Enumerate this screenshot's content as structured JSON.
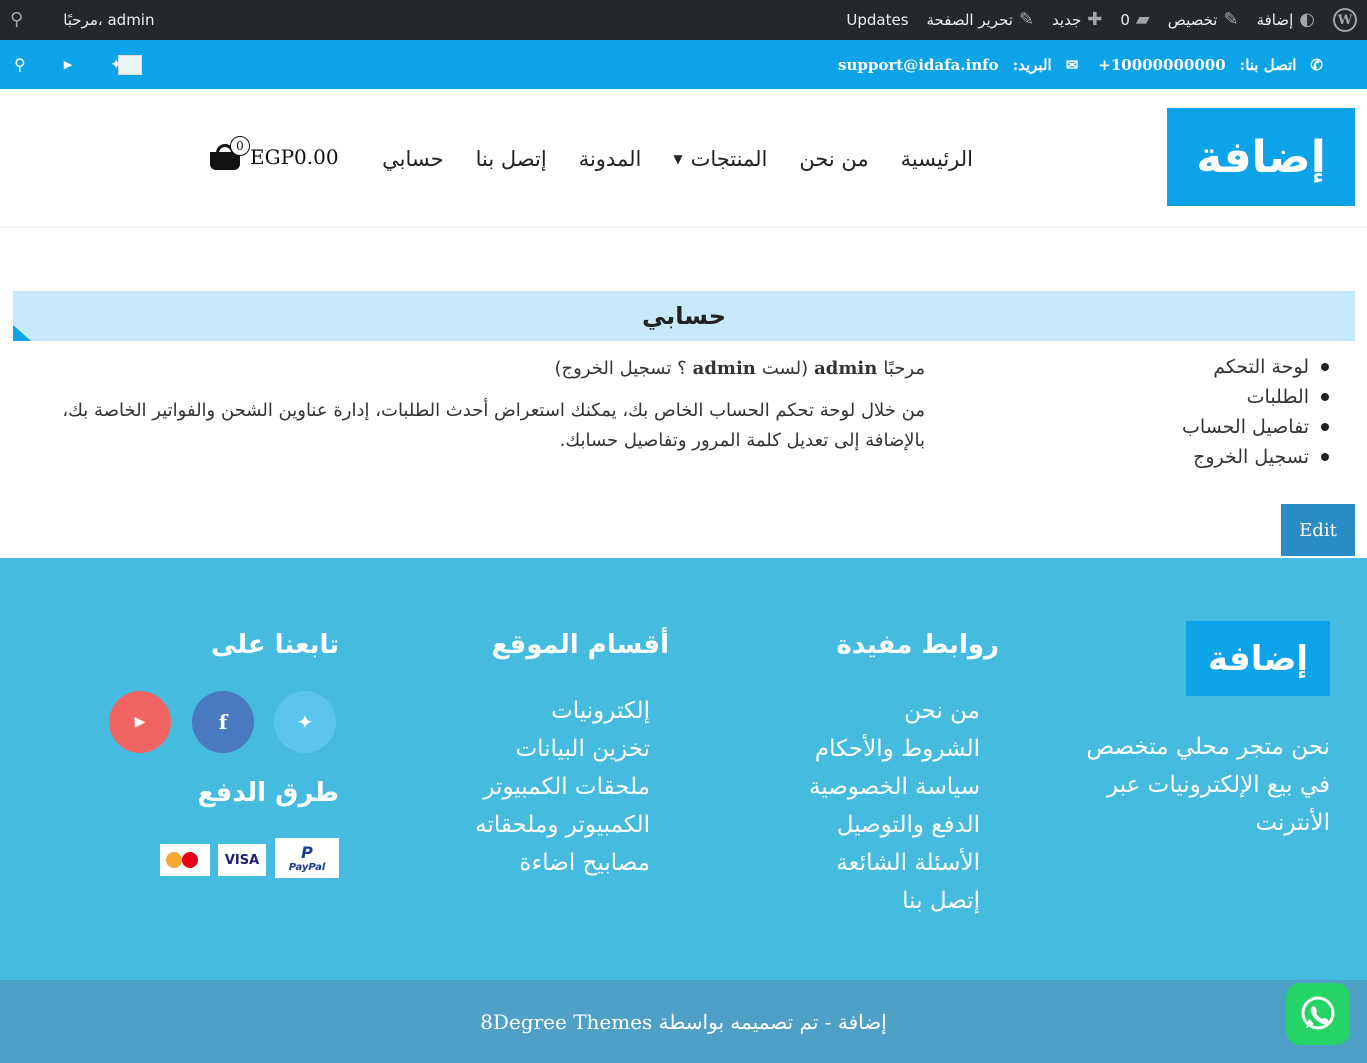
{
  "admin_bar": {
    "site_name": "إضافة",
    "customize": "تخصيص",
    "comments_count": "0",
    "new": "جديد",
    "edit_page": "تحرير الصفحة",
    "updates": "Updates",
    "greeting": "مرحبًا، admin"
  },
  "topbar": {
    "phone_label": "اتصل بنا:",
    "phone": "+10000000000",
    "email_label": "البريد:",
    "email": "support@idafa.info"
  },
  "header": {
    "logo_text": "إضافة",
    "nav": [
      "الرئيسية",
      "من نحن",
      "المنتجات",
      "المدونة",
      "إتصل بنا",
      "حسابي"
    ],
    "cart_count": "0",
    "cart_total": "EGP0.00"
  },
  "page": {
    "title": "حسابي",
    "account_nav": [
      "لوحة التحكم",
      "الطلبات",
      "تفاصيل الحساب",
      "تسجيل الخروج"
    ],
    "hello_prefix": "مرحبًا",
    "hello_user": "admin",
    "hello_paren_open": "(لست",
    "hello_user2": "admin",
    "hello_logout": "؟ تسجيل الخروج)",
    "description": "من خلال لوحة تحكم الحساب الخاص بك، يمكنك استعراض أحدث الطلبات، إدارة عناوين الشحن والفواتير الخاصة بك، بالإضافة إلى تعديل كلمة المرور وتفاصيل حسابك.",
    "edit_button": "Edit"
  },
  "footer": {
    "logo_text": "إضافة",
    "about": "نحن متجر محلي متخصص في بيع الإلكترونيات عبر الأنترنت",
    "useful_links_title": "روابط مفيدة",
    "useful_links": [
      "من نحن",
      "الشروط والأحكام",
      "سياسة الخصوصية",
      "الدفع والتوصيل",
      "الأسئلة الشائعة",
      "إتصل بنا"
    ],
    "sections_title": "أقسام الموقع",
    "sections": [
      "إلكترونيات",
      "تخزين البيانات",
      "ملحقات الكمبيوتر",
      "الكمبيوتر وملحقاته",
      "مصابيح اضاءة"
    ],
    "follow_title": "تابعنا على",
    "payment_title": "طرق الدفع",
    "payment_visa": "VISA",
    "payment_paypal": "PayPal",
    "copyright": "إضافة - تم تصميمه بواسطة 8Degree Themes"
  },
  "colors": {
    "admin_bar": "#23282d",
    "primary": "#0ca3e8",
    "footer": "#46bbe0",
    "copyright": "#4ea0c7",
    "title_band": "#c6e9fb",
    "twitter": "#5bc5ef",
    "facebook": "#4a79c0",
    "youtube": "#f06463",
    "whatsapp": "#25d366"
  }
}
